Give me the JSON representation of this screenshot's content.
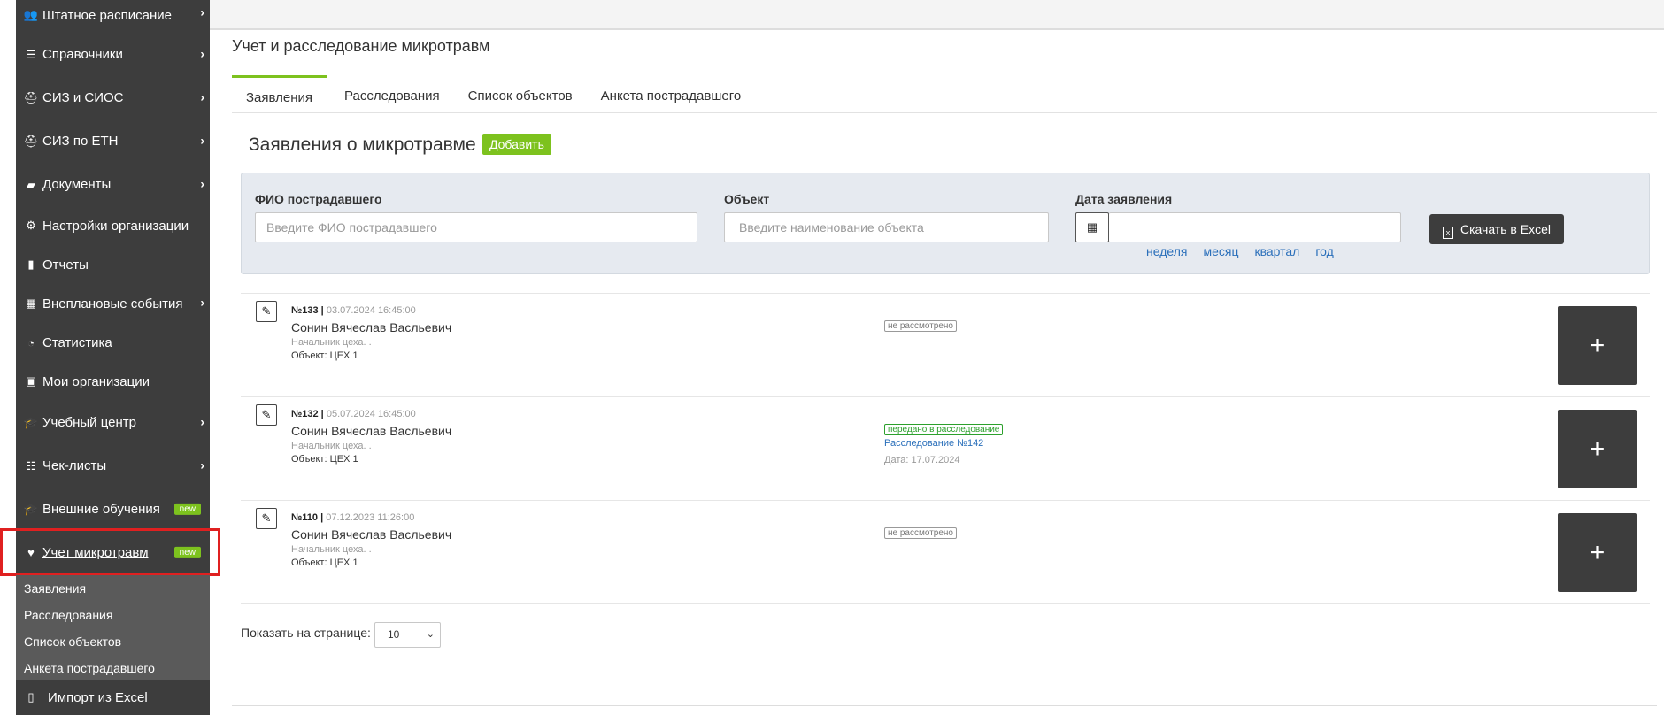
{
  "sidebar": {
    "items": [
      {
        "label": "Штатное расписание",
        "icon": "users-icon"
      },
      {
        "label": "Справочники",
        "icon": "list-icon"
      },
      {
        "label": "СИЗ и СИОС",
        "icon": "helmet-icon"
      },
      {
        "label": "СИЗ по ЕТН",
        "icon": "helmet-icon"
      },
      {
        "label": "Документы",
        "icon": "folder-icon"
      },
      {
        "label": "Настройки организации",
        "icon": "gear-icon"
      },
      {
        "label": "Отчеты",
        "icon": "clipboard-icon"
      },
      {
        "label": "Внеплановые события",
        "icon": "calendar-icon"
      },
      {
        "label": "Статистика",
        "icon": "pie-chart-icon"
      },
      {
        "label": "Мои организации",
        "icon": "briefcase-icon"
      },
      {
        "label": "Учебный центр",
        "icon": "graduation-cap-icon"
      },
      {
        "label": "Чек-листы",
        "icon": "checklist-icon"
      },
      {
        "label": "Внешние обучения",
        "icon": "graduation-cap-icon",
        "badge": "new"
      },
      {
        "label": "Учет микротравм",
        "icon": "heart-pulse-icon",
        "badge": "new"
      }
    ],
    "subitems": [
      "Заявления",
      "Расследования",
      "Список объектов",
      "Анкета пострадавшего"
    ],
    "import_item": {
      "label": "Импорт из Excel",
      "icon": "excel-file-icon"
    }
  },
  "page": {
    "title": "Учет и расследование микротравм",
    "tabs": [
      "Заявления",
      "Расследования",
      "Список объектов",
      "Анкета пострадавшего"
    ]
  },
  "section": {
    "title": "Заявления о микротравме",
    "add_label": "Добавить"
  },
  "filters": {
    "fio_label": "ФИО пострадавшего",
    "fio_placeholder": "Введите ФИО пострадавшего",
    "object_label": "Объект",
    "object_placeholder": "Введите наименование объекта",
    "date_label": "Дата заявления",
    "periods": [
      "неделя",
      "месяц",
      "квартал",
      "год"
    ],
    "excel_label": "Скачать в Excel"
  },
  "rows": [
    {
      "num": "№133",
      "date": "03.07.2024 16:45:00",
      "name": "Сонин Вячеслав Васльевич",
      "position": "Начальник цеха. .",
      "object": "Объект: ЦЕХ 1",
      "status": "не рассмотрено"
    },
    {
      "num": "№132",
      "date": "05.07.2024 16:45:00",
      "name": "Сонин Вячеслав Васльевич",
      "position": "Начальник цеха. .",
      "object": "Объект: ЦЕХ 1",
      "status": "передано в расследование",
      "investigation": "Расследование №142",
      "investigation_date": "Дата: 17.07.2024"
    },
    {
      "num": "№110",
      "date": "07.12.2023 11:26:00",
      "name": "Сонин Вячеслав Васльевич",
      "position": "Начальник цеха. .",
      "object": "Объект: ЦЕХ 1",
      "status": "не рассмотрено"
    }
  ],
  "pagination": {
    "label": "Показать на странице:",
    "value": "10"
  },
  "colors": {
    "accent": "#7dc21e",
    "sidebar": "#3d3d3d",
    "highlight": "#e02020",
    "link": "#2a6fba"
  }
}
